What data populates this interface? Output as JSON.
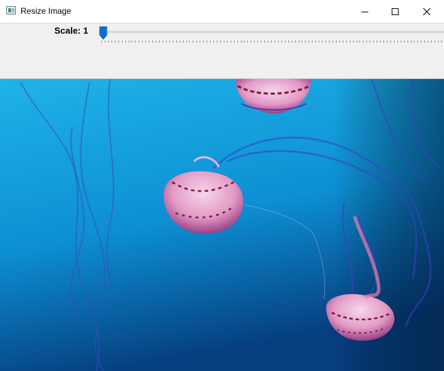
{
  "window": {
    "title": "Resize Image",
    "icon": "image-app-icon",
    "controls": [
      "minimize-icon",
      "maximize-icon",
      "close-icon"
    ]
  },
  "toolbar": {
    "scale_label": "Scale: 1",
    "slider": {
      "value": 1,
      "position_fraction": 0.0
    }
  },
  "image": {
    "subject": "jellyfish",
    "colors": {
      "water_top": "#18a8e0",
      "water_bottom": "#0a4f8f",
      "jelly": "#e8a0c8",
      "jelly_dark": "#8a1d3e"
    }
  }
}
